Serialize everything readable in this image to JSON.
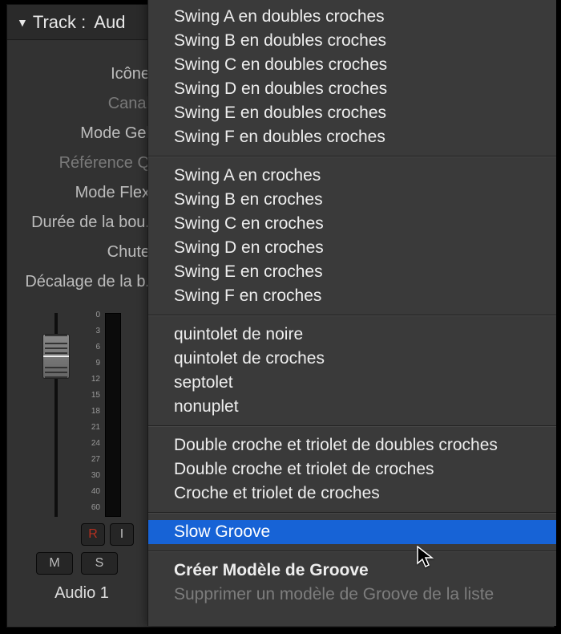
{
  "header": {
    "label": "Track :",
    "value": "Aud"
  },
  "properties": [
    {
      "label": "Icône",
      "dim": false
    },
    {
      "label": "Canal",
      "dim": true
    },
    {
      "label": "Mode Gel",
      "dim": false
    },
    {
      "label": "Référence Q",
      "dim": true
    },
    {
      "label": "Mode Flex",
      "dim": false
    },
    {
      "label": "Durée de la bou.",
      "dim": false
    },
    {
      "label": "Chute",
      "dim": false
    },
    {
      "label": "Décalage de la b.",
      "dim": false
    }
  ],
  "scale_marks": [
    "0",
    "3",
    "6",
    "9",
    "12",
    "15",
    "18",
    "21",
    "24",
    "27",
    "30",
    "40",
    "60"
  ],
  "buttons": {
    "rec": "R",
    "input": "I",
    "mute": "M",
    "solo": "S"
  },
  "track_name": "Audio 1",
  "menu": {
    "groups": [
      [
        "Swing A en doubles croches",
        "Swing B en doubles croches",
        "Swing C en doubles croches",
        "Swing D en doubles croches",
        "Swing E en doubles croches",
        "Swing F en doubles croches"
      ],
      [
        "Swing A en croches",
        "Swing B en croches",
        "Swing C en croches",
        "Swing D en croches",
        "Swing E en croches",
        "Swing F en croches"
      ],
      [
        "quintolet de noire",
        "quintolet de croches",
        "septolet",
        "nonuplet"
      ],
      [
        "Double croche et triolet de doubles croches",
        "Double croche et triolet de croches",
        "Croche et triolet de croches"
      ]
    ],
    "selected": "Slow Groove",
    "footer_bold": "Créer Modèle de Groove",
    "footer_disabled": "Supprimer un modèle de Groove de la liste"
  }
}
